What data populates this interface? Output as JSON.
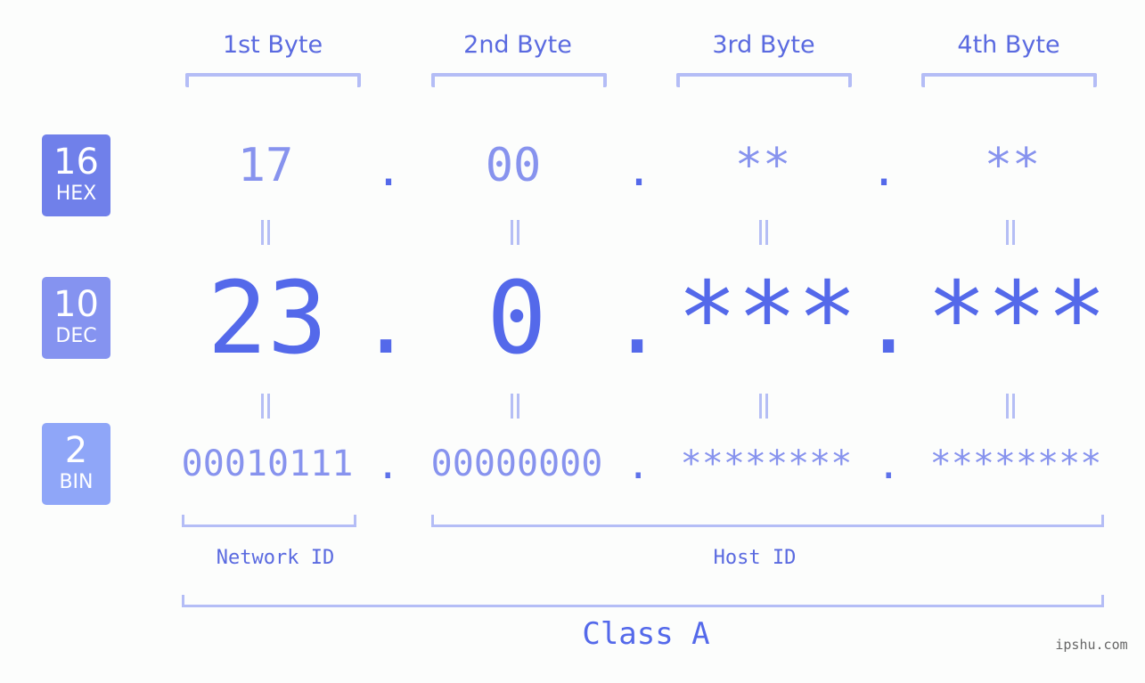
{
  "bases": [
    {
      "number": "16",
      "label": "HEX"
    },
    {
      "number": "10",
      "label": "DEC"
    },
    {
      "number": "2",
      "label": "BIN"
    }
  ],
  "byte_headers": [
    "1st Byte",
    "2nd Byte",
    "3rd Byte",
    "4th Byte"
  ],
  "hex": [
    "17",
    "00",
    "**",
    "**"
  ],
  "dec": [
    "23",
    "0",
    "***",
    "***"
  ],
  "bin": [
    "00010111",
    "00000000",
    "********",
    "********"
  ],
  "separator": ".",
  "network_label": "Network ID",
  "host_label": "Host ID",
  "class_label": "Class A",
  "watermark": "ipshu.com",
  "colors": {
    "accent": "#5469ea",
    "light_value": "#8793ee",
    "bracket": "#b4bdf6",
    "hex_badge": "#7080ea",
    "dec_badge": "#8593f0",
    "bin_badge": "#8fa6f8"
  }
}
